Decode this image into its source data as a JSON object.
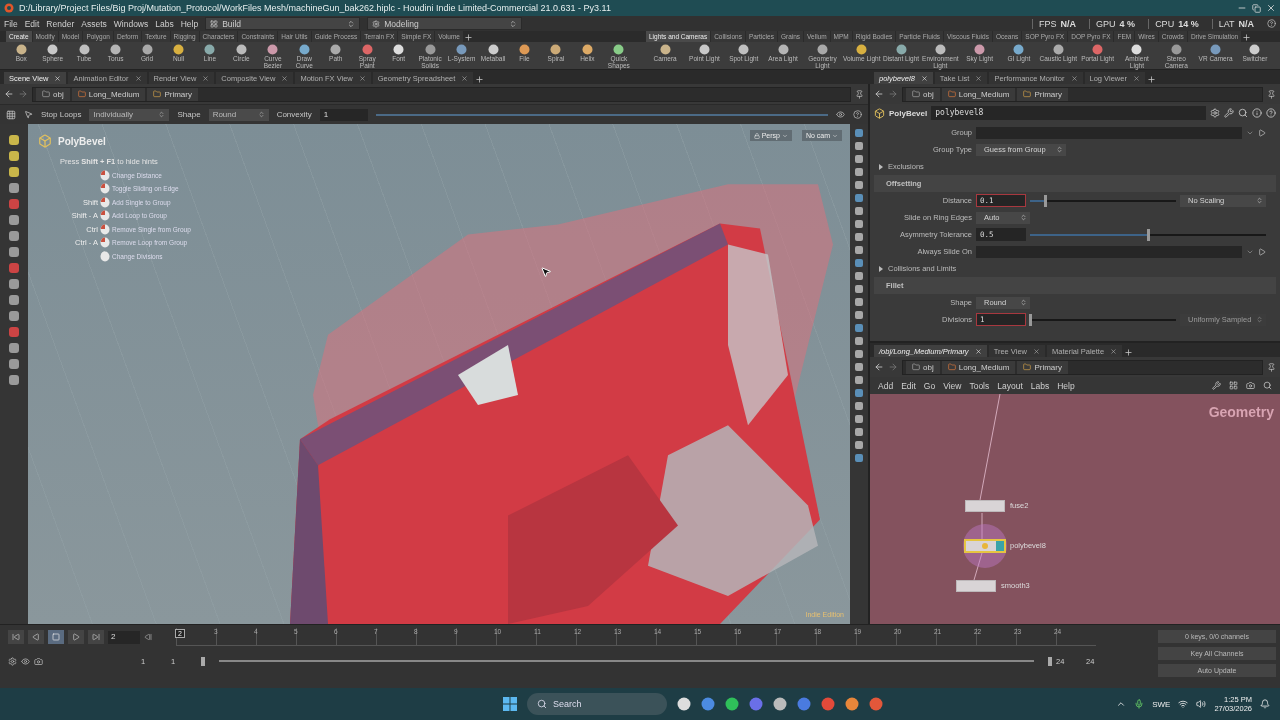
{
  "window": {
    "title": "D:/Library/Project Files/Big Proj/Mutation_Protocol/WorkFiles Mesh/machineGun_bak262.hiplc - Houdini Indie Limited-Commercial 21.0.631 - Py3.11"
  },
  "menu": [
    "File",
    "Edit",
    "Render",
    "Assets",
    "Windows",
    "Labs",
    "Help"
  ],
  "desktop_menus": [
    {
      "kind": "layout",
      "label": "Build"
    },
    {
      "kind": "context",
      "label": "Modeling"
    }
  ],
  "stats": [
    {
      "label": "FPS",
      "value": "N/A"
    },
    {
      "label": "GPU",
      "value": "4 %"
    },
    {
      "label": "CPU",
      "value": "14 %"
    },
    {
      "label": "LAT",
      "value": "N/A"
    }
  ],
  "shelf_left": {
    "tabs": [
      {
        "label": "Create",
        "selected": true
      },
      {
        "label": "Modify",
        "selected": false
      },
      {
        "label": "Model",
        "selected": false
      },
      {
        "label": "Polygon",
        "selected": false
      },
      {
        "label": "Deform",
        "selected": false
      },
      {
        "label": "Texture",
        "selected": false
      },
      {
        "label": "Rigging",
        "selected": false
      },
      {
        "label": "Characters",
        "selected": false
      },
      {
        "label": "Constraints",
        "selected": false
      },
      {
        "label": "Hair Utils",
        "selected": false
      },
      {
        "label": "Guide Process",
        "selected": false
      },
      {
        "label": "Terrain FX",
        "selected": false
      },
      {
        "label": "Simple FX",
        "selected": false
      },
      {
        "label": "Volume",
        "selected": false
      }
    ],
    "tools": [
      "Box",
      "Sphere",
      "Tube",
      "Torus",
      "Grid",
      "Null",
      "Line",
      "Circle",
      "Curve Bezier",
      "Draw Curve",
      "Path",
      "Spray Paint",
      "Font",
      "Platonic Solids",
      "L-System",
      "Metaball",
      "File",
      "Spiral",
      "Helix",
      "Quick Shapes"
    ]
  },
  "shelf_right": {
    "tabs": [
      {
        "label": "Lights and Cameras",
        "selected": true
      },
      {
        "label": "Collisions",
        "selected": false
      },
      {
        "label": "Particles",
        "selected": false
      },
      {
        "label": "Grains",
        "selected": false
      },
      {
        "label": "Vellum",
        "selected": false
      },
      {
        "label": "MPM",
        "selected": false
      },
      {
        "label": "Rigid Bodies",
        "selected": false
      },
      {
        "label": "Particle Fluids",
        "selected": false
      },
      {
        "label": "Viscous Fluids",
        "selected": false
      },
      {
        "label": "Oceans",
        "selected": false
      },
      {
        "label": "SOP Pyro FX",
        "selected": false
      },
      {
        "label": "DOP Pyro FX",
        "selected": false
      },
      {
        "label": "FEM",
        "selected": false
      },
      {
        "label": "Wires",
        "selected": false
      },
      {
        "label": "Crowds",
        "selected": false
      },
      {
        "label": "Drive Simulation",
        "selected": false
      }
    ],
    "tools": [
      "Camera",
      "Point Light",
      "Spot Light",
      "Area Light",
      "Geometry Light",
      "Volume Light",
      "Distant Light",
      "Environment Light",
      "Sky Light",
      "GI Light",
      "Caustic Light",
      "Portal Light",
      "Ambient Light",
      "Stereo Camera",
      "VR Camera",
      "Switcher"
    ]
  },
  "pane_tabs_left": [
    {
      "label": "Scene View",
      "selected": true
    },
    {
      "label": "Animation Editor",
      "selected": false
    },
    {
      "label": "Render View",
      "selected": false
    },
    {
      "label": "Composite View",
      "selected": false
    },
    {
      "label": "Motion FX View",
      "selected": false
    },
    {
      "label": "Geometry Spreadsheet",
      "selected": false
    }
  ],
  "pane_tabs_right": [
    {
      "label": "polybevel8",
      "selected": true
    },
    {
      "label": "Take List",
      "selected": false
    },
    {
      "label": "Performance Monitor",
      "selected": false
    },
    {
      "label": "Log Viewer",
      "selected": false
    }
  ],
  "left_path": [
    "obj",
    "Long_Medium",
    "Primary"
  ],
  "tool_options": {
    "stop_loops": "Stop Loops",
    "loop_mode": "Individually",
    "shape_label": "Shape",
    "shape": "Round",
    "convexity_label": "Convexity",
    "convexity": "1",
    "convexity_slider": {
      "level": 1
    }
  },
  "viewport": {
    "tool_title": "PolyBevel",
    "hint": "Press **Shift + F1** to hide hints",
    "hints": [
      {
        "text": "Change Distance"
      },
      {
        "text": "Toggle Sliding on Edge"
      },
      {
        "keys": "Shift",
        "text": "Add Single to Group"
      },
      {
        "keys": "Shift - A",
        "text": "Add Loop to Group"
      },
      {
        "keys": "Ctrl",
        "text": "Remove Single from Group"
      },
      {
        "keys": "Ctrl - A",
        "text": "Remove Loop from Group"
      },
      {
        "text": "Change Divisions"
      }
    ],
    "camera": "Persp",
    "cam_menu": "No cam",
    "edition": "Indie Edition"
  },
  "right_path": [
    "obj",
    "Long_Medium",
    "Primary"
  ],
  "params": {
    "node_type": "PolyBevel",
    "node_name": "polybevel8",
    "rows": [
      {
        "kind": "field",
        "label": "Group"
      },
      {
        "kind": "menu",
        "label": "Group Type",
        "value": "Guess from Group"
      },
      {
        "kind": "folder",
        "label": "Exclusions",
        "expanded": false
      },
      {
        "kind": "section",
        "label": "Offsetting"
      },
      {
        "kind": "slider",
        "label": "Distance",
        "value": "0.1",
        "level": 0.1,
        "highlighted": true,
        "menu": "No Scaling",
        "menu_disabled": false
      },
      {
        "kind": "menu",
        "label": "Slide on Ring Edges",
        "value": "Auto"
      },
      {
        "kind": "slider",
        "label": "Asymmetry Tolerance",
        "value": "0.5",
        "level": 0.5,
        "highlighted": false
      },
      {
        "kind": "field",
        "label": "Always Slide On"
      },
      {
        "kind": "folder",
        "label": "Collisions and Limits",
        "expanded": false
      },
      {
        "kind": "section",
        "label": "Fillet"
      },
      {
        "kind": "menu",
        "label": "Shape",
        "value": "Round"
      },
      {
        "kind": "slider",
        "label": "Divisions",
        "value": "1",
        "level": 0,
        "highlighted": true,
        "menu": "Uniformly Sampled",
        "menu_disabled": true
      }
    ]
  },
  "network": {
    "tabs": [
      {
        "label": "/obj/Long_Medium/Primary",
        "selected": true
      },
      {
        "label": "Tree View",
        "selected": false
      },
      {
        "label": "Material Palette",
        "selected": false
      }
    ],
    "path": [
      "obj",
      "Long_Medium",
      "Primary"
    ],
    "menu": [
      "Add",
      "Edit",
      "Go",
      "View",
      "Tools",
      "Layout",
      "Labs",
      "Help"
    ],
    "context": "Geometry",
    "nodes": [
      {
        "name": "fuse2",
        "selected": false,
        "display": false,
        "warning": false
      },
      {
        "name": "polybevel8",
        "selected": true,
        "display": true,
        "warning": true
      },
      {
        "name": "smooth3",
        "selected": false,
        "display": false,
        "warning": false
      }
    ]
  },
  "timeline": {
    "frame": "2",
    "current": "2",
    "ticks": [
      "3",
      "4",
      "5",
      "6",
      "7",
      "8",
      "9",
      "10",
      "11",
      "12",
      "13",
      "14",
      "15",
      "16",
      "17",
      "18",
      "19",
      "20",
      "21",
      "22",
      "23",
      "24"
    ],
    "range_start": "1",
    "start": "1",
    "end": "24",
    "range_end": "24",
    "keys_info": "0 keys, 0/0 channels",
    "key_button": "Key All Channels",
    "update_mode": "Auto Update"
  },
  "taskbar": {
    "search": "Search",
    "language": "SWE",
    "time": "1:25 PM",
    "date": "27/03/2026"
  }
}
